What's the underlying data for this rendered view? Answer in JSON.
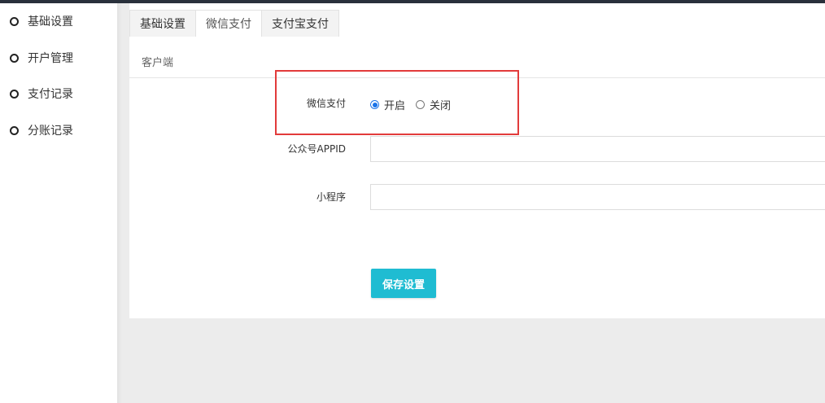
{
  "sidebar": {
    "items": [
      {
        "label": "基础设置"
      },
      {
        "label": "开户管理"
      },
      {
        "label": "支付记录"
      },
      {
        "label": "分账记录"
      }
    ]
  },
  "tabs": [
    {
      "label": "基础设置",
      "active": false
    },
    {
      "label": "微信支付",
      "active": true
    },
    {
      "label": "支付宝支付",
      "active": false
    }
  ],
  "subtab": {
    "label": "客户端"
  },
  "form": {
    "wechat_pay": {
      "label": "微信支付",
      "options": [
        {
          "label": "开启",
          "checked": true
        },
        {
          "label": "关闭",
          "checked": false
        }
      ]
    },
    "appid": {
      "label": "公众号APPID",
      "value": ""
    },
    "miniprogram": {
      "label": "小程序",
      "value": ""
    },
    "save_label": "保存设置"
  },
  "colors": {
    "accent": "#1fbcd2",
    "radio_checked": "#1a73e8",
    "highlight": "#e23b3b",
    "topbar": "#2a313c"
  }
}
